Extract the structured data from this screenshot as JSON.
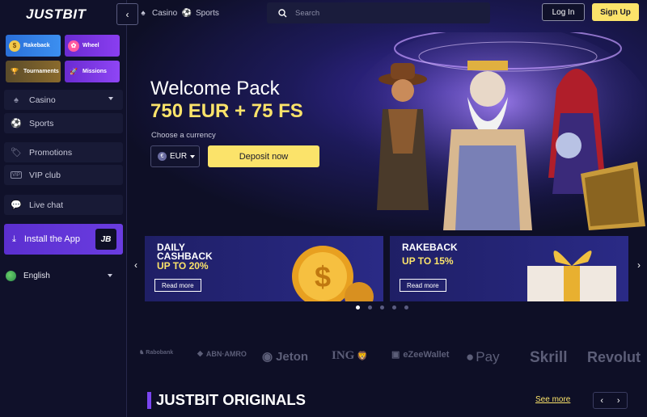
{
  "brand": {
    "logo": "JUSTBIT"
  },
  "sidebar": {
    "tiles": [
      {
        "label": "Rakeback",
        "icon": "rakeback-icon"
      },
      {
        "label": "Wheel",
        "icon": "wheel-icon"
      },
      {
        "label": "Tournaments",
        "icon": "trophy-icon"
      },
      {
        "label": "Missions",
        "icon": "rocket-icon"
      }
    ],
    "items": [
      {
        "label": "Casino",
        "icon": "spade-icon"
      },
      {
        "label": "Sports",
        "icon": "soccer-ball-icon"
      },
      {
        "label": "Promotions",
        "icon": "tag-icon"
      },
      {
        "label": "VIP club",
        "icon": "vip-icon"
      },
      {
        "label": "Live chat",
        "icon": "chat-icon"
      }
    ],
    "install_label": "Install the App",
    "install_badge": "JB",
    "language": "English"
  },
  "topbar": {
    "casino": "Casino",
    "sports": "Sports",
    "search_placeholder": "Search",
    "login": "Log In",
    "signup": "Sign Up"
  },
  "hero": {
    "title": "Welcome Pack",
    "amount": "750 EUR + 75 FS",
    "choose_currency": "Choose a currency",
    "currency": "EUR",
    "deposit": "Deposit now"
  },
  "promos": [
    {
      "line1": "DAILY",
      "line2": "CASHBACK",
      "sub": "UP TO 20%",
      "button": "Read more"
    },
    {
      "line1": "RAKEBACK",
      "line2": "",
      "sub": "UP TO 15%",
      "button": "Read more"
    }
  ],
  "carousel": {
    "pages": 5,
    "active": 0
  },
  "payments": [
    "Rabobank",
    "ABN·AMRO",
    "Jeton",
    "ING",
    "eZeeWallet",
    "Pay",
    "Skrill",
    "Revolut"
  ],
  "originals": {
    "title": "JUSTBIT ORIGINALS",
    "see_more": "See more"
  },
  "colors": {
    "accent": "#fbe36a",
    "primary": "#6a3ce0",
    "background": "#0e0f26"
  }
}
